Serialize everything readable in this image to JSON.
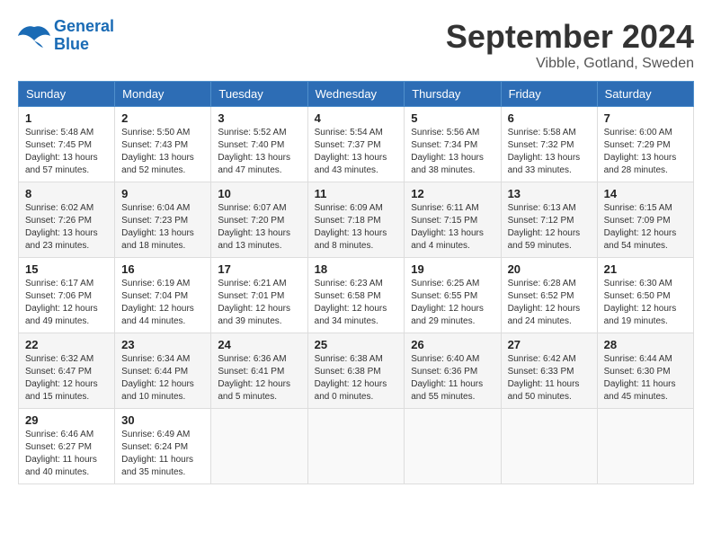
{
  "header": {
    "logo_line1": "General",
    "logo_line2": "Blue",
    "month": "September 2024",
    "location": "Vibble, Gotland, Sweden"
  },
  "weekdays": [
    "Sunday",
    "Monday",
    "Tuesday",
    "Wednesday",
    "Thursday",
    "Friday",
    "Saturday"
  ],
  "weeks": [
    [
      {
        "day": "1",
        "info": "Sunrise: 5:48 AM\nSunset: 7:45 PM\nDaylight: 13 hours\nand 57 minutes."
      },
      {
        "day": "2",
        "info": "Sunrise: 5:50 AM\nSunset: 7:43 PM\nDaylight: 13 hours\nand 52 minutes."
      },
      {
        "day": "3",
        "info": "Sunrise: 5:52 AM\nSunset: 7:40 PM\nDaylight: 13 hours\nand 47 minutes."
      },
      {
        "day": "4",
        "info": "Sunrise: 5:54 AM\nSunset: 7:37 PM\nDaylight: 13 hours\nand 43 minutes."
      },
      {
        "day": "5",
        "info": "Sunrise: 5:56 AM\nSunset: 7:34 PM\nDaylight: 13 hours\nand 38 minutes."
      },
      {
        "day": "6",
        "info": "Sunrise: 5:58 AM\nSunset: 7:32 PM\nDaylight: 13 hours\nand 33 minutes."
      },
      {
        "day": "7",
        "info": "Sunrise: 6:00 AM\nSunset: 7:29 PM\nDaylight: 13 hours\nand 28 minutes."
      }
    ],
    [
      {
        "day": "8",
        "info": "Sunrise: 6:02 AM\nSunset: 7:26 PM\nDaylight: 13 hours\nand 23 minutes."
      },
      {
        "day": "9",
        "info": "Sunrise: 6:04 AM\nSunset: 7:23 PM\nDaylight: 13 hours\nand 18 minutes."
      },
      {
        "day": "10",
        "info": "Sunrise: 6:07 AM\nSunset: 7:20 PM\nDaylight: 13 hours\nand 13 minutes."
      },
      {
        "day": "11",
        "info": "Sunrise: 6:09 AM\nSunset: 7:18 PM\nDaylight: 13 hours\nand 8 minutes."
      },
      {
        "day": "12",
        "info": "Sunrise: 6:11 AM\nSunset: 7:15 PM\nDaylight: 13 hours\nand 4 minutes."
      },
      {
        "day": "13",
        "info": "Sunrise: 6:13 AM\nSunset: 7:12 PM\nDaylight: 12 hours\nand 59 minutes."
      },
      {
        "day": "14",
        "info": "Sunrise: 6:15 AM\nSunset: 7:09 PM\nDaylight: 12 hours\nand 54 minutes."
      }
    ],
    [
      {
        "day": "15",
        "info": "Sunrise: 6:17 AM\nSunset: 7:06 PM\nDaylight: 12 hours\nand 49 minutes."
      },
      {
        "day": "16",
        "info": "Sunrise: 6:19 AM\nSunset: 7:04 PM\nDaylight: 12 hours\nand 44 minutes."
      },
      {
        "day": "17",
        "info": "Sunrise: 6:21 AM\nSunset: 7:01 PM\nDaylight: 12 hours\nand 39 minutes."
      },
      {
        "day": "18",
        "info": "Sunrise: 6:23 AM\nSunset: 6:58 PM\nDaylight: 12 hours\nand 34 minutes."
      },
      {
        "day": "19",
        "info": "Sunrise: 6:25 AM\nSunset: 6:55 PM\nDaylight: 12 hours\nand 29 minutes."
      },
      {
        "day": "20",
        "info": "Sunrise: 6:28 AM\nSunset: 6:52 PM\nDaylight: 12 hours\nand 24 minutes."
      },
      {
        "day": "21",
        "info": "Sunrise: 6:30 AM\nSunset: 6:50 PM\nDaylight: 12 hours\nand 19 minutes."
      }
    ],
    [
      {
        "day": "22",
        "info": "Sunrise: 6:32 AM\nSunset: 6:47 PM\nDaylight: 12 hours\nand 15 minutes."
      },
      {
        "day": "23",
        "info": "Sunrise: 6:34 AM\nSunset: 6:44 PM\nDaylight: 12 hours\nand 10 minutes."
      },
      {
        "day": "24",
        "info": "Sunrise: 6:36 AM\nSunset: 6:41 PM\nDaylight: 12 hours\nand 5 minutes."
      },
      {
        "day": "25",
        "info": "Sunrise: 6:38 AM\nSunset: 6:38 PM\nDaylight: 12 hours\nand 0 minutes."
      },
      {
        "day": "26",
        "info": "Sunrise: 6:40 AM\nSunset: 6:36 PM\nDaylight: 11 hours\nand 55 minutes."
      },
      {
        "day": "27",
        "info": "Sunrise: 6:42 AM\nSunset: 6:33 PM\nDaylight: 11 hours\nand 50 minutes."
      },
      {
        "day": "28",
        "info": "Sunrise: 6:44 AM\nSunset: 6:30 PM\nDaylight: 11 hours\nand 45 minutes."
      }
    ],
    [
      {
        "day": "29",
        "info": "Sunrise: 6:46 AM\nSunset: 6:27 PM\nDaylight: 11 hours\nand 40 minutes."
      },
      {
        "day": "30",
        "info": "Sunrise: 6:49 AM\nSunset: 6:24 PM\nDaylight: 11 hours\nand 35 minutes."
      },
      {
        "day": "",
        "info": ""
      },
      {
        "day": "",
        "info": ""
      },
      {
        "day": "",
        "info": ""
      },
      {
        "day": "",
        "info": ""
      },
      {
        "day": "",
        "info": ""
      }
    ]
  ]
}
